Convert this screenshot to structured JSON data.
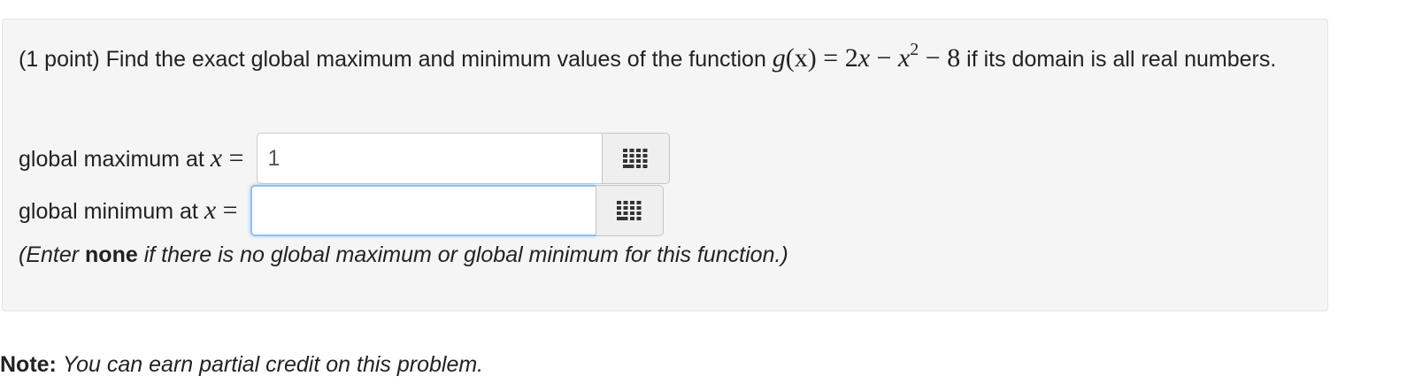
{
  "problem": {
    "intro": "(1 point) Find the exact global maximum and minimum values of the function ",
    "func_g": "g",
    "func_paren_x": "(x)",
    "func_eq": " = 2",
    "func_x": "x",
    "func_minus": " − ",
    "func_x2": "x",
    "func_exp": "2",
    "func_tail": " − 8",
    "suffix": " if its domain is all real numbers."
  },
  "answers": {
    "max_label": "global maximum at ",
    "max_var": "x",
    "max_eq": " =",
    "max_value": "1",
    "min_label": "global minimum at ",
    "min_var": "x",
    "min_eq": " =",
    "min_value": ""
  },
  "hint": {
    "prefix": "(Enter ",
    "bold": "none",
    "suffix": " if there is no global maximum or global minimum for this function.)"
  },
  "note": {
    "label": "Note:",
    "text": "You can earn partial credit on this problem."
  },
  "icons": {
    "keypad": "keypad-grid-icon"
  },
  "colors": {
    "panel_bg": "#f5f5f5",
    "focus_border": "#93bdf2",
    "keypad_dots": "#333333"
  }
}
